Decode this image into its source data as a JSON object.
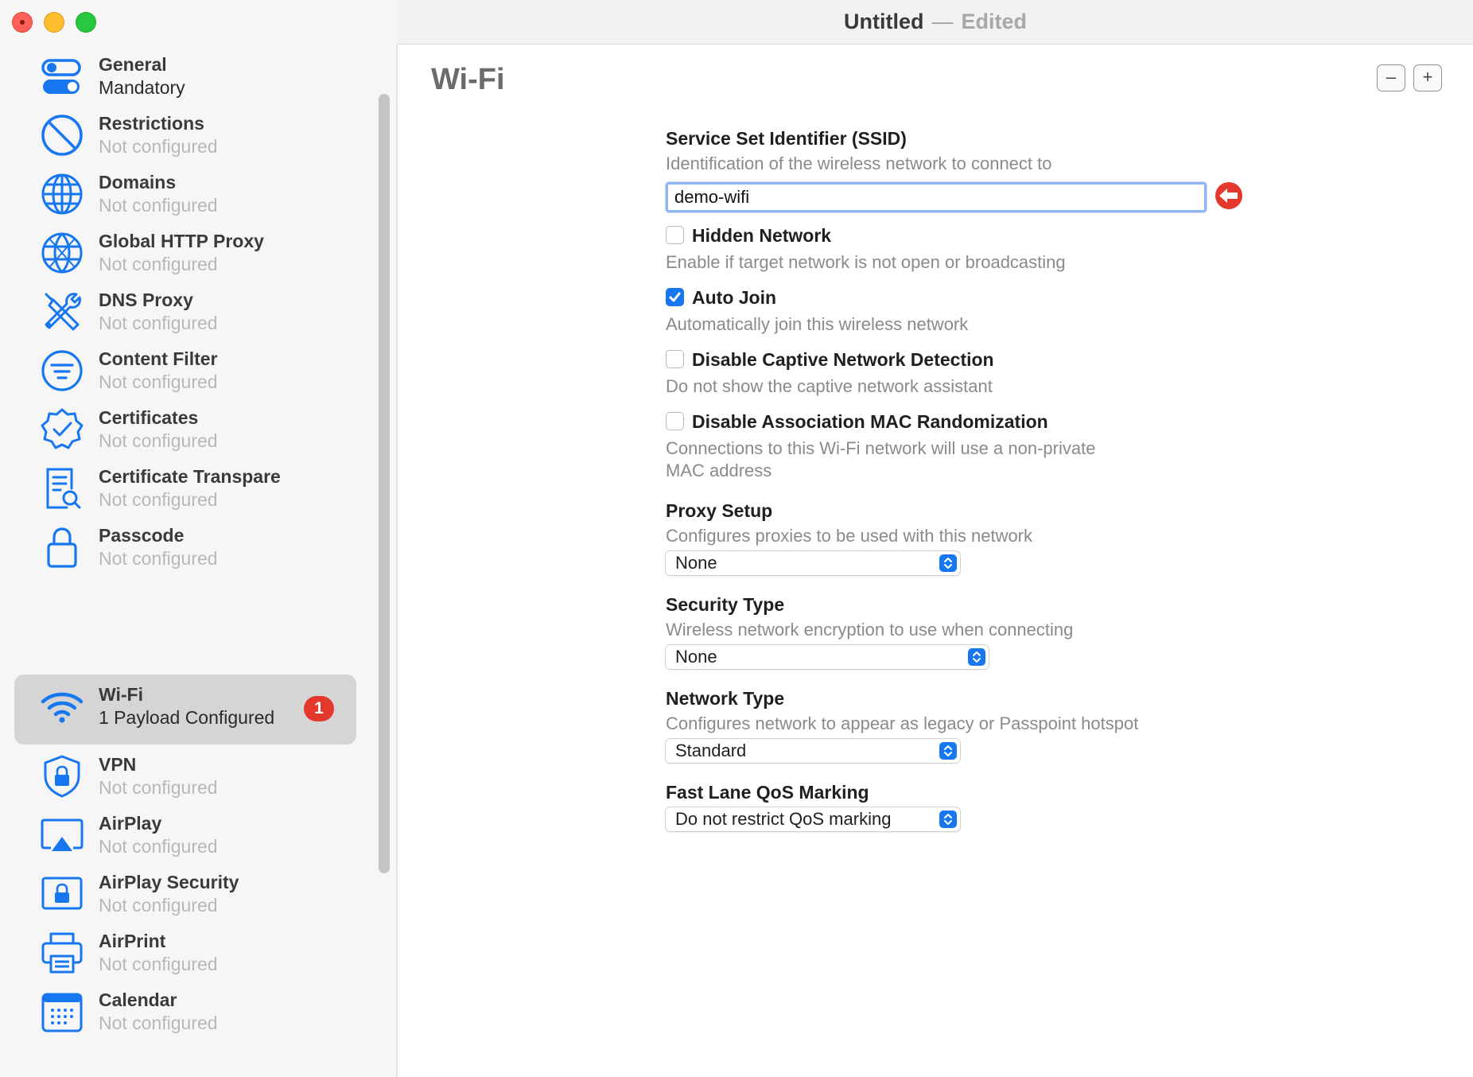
{
  "window": {
    "title": "Untitled",
    "separator": "—",
    "status": "Edited"
  },
  "sidebar": {
    "items": [
      {
        "title": "General",
        "subtitle": "Mandatory",
        "icon": "toggle-icon"
      },
      {
        "title": "Restrictions",
        "subtitle": "Not configured",
        "icon": "prohibited-icon"
      },
      {
        "title": "Domains",
        "subtitle": "Not configured",
        "icon": "globe-icon"
      },
      {
        "title": "Global HTTP Proxy",
        "subtitle": "Not configured",
        "icon": "globe-network-icon"
      },
      {
        "title": "DNS Proxy",
        "subtitle": "Not configured",
        "icon": "tools-icon"
      },
      {
        "title": "Content Filter",
        "subtitle": "Not configured",
        "icon": "filter-icon"
      },
      {
        "title": "Certificates",
        "subtitle": "Not configured",
        "icon": "certificate-icon"
      },
      {
        "title": "Certificate Transpare",
        "subtitle": "Not configured",
        "icon": "document-search-icon"
      },
      {
        "title": "Passcode",
        "subtitle": "Not configured",
        "icon": "lock-icon"
      },
      {
        "title": "Wi-Fi",
        "subtitle": "1 Payload Configured",
        "icon": "wifi-icon",
        "badge": "1"
      },
      {
        "title": "VPN",
        "subtitle": "Not configured",
        "icon": "shield-lock-icon"
      },
      {
        "title": "AirPlay",
        "subtitle": "Not configured",
        "icon": "airplay-icon"
      },
      {
        "title": "AirPlay Security",
        "subtitle": "Not configured",
        "icon": "airplay-lock-icon"
      },
      {
        "title": "AirPrint",
        "subtitle": "Not configured",
        "icon": "printer-icon"
      },
      {
        "title": "Calendar",
        "subtitle": "Not configured",
        "icon": "calendar-icon"
      }
    ]
  },
  "main": {
    "title": "Wi-Fi",
    "remove_label": "–",
    "add_label": "+",
    "ssid": {
      "title": "Service Set Identifier (SSID)",
      "desc": "Identification of the wireless network to connect to",
      "value": "demo-wifi"
    },
    "hidden_network": {
      "label": "Hidden Network",
      "desc": "Enable if target network is not open or broadcasting",
      "checked": false
    },
    "auto_join": {
      "label": "Auto Join",
      "desc": "Automatically join this wireless network",
      "checked": true
    },
    "captive": {
      "label": "Disable Captive Network Detection",
      "desc": "Do not show the captive network assistant",
      "checked": false
    },
    "mac_random": {
      "label": "Disable Association MAC Randomization",
      "desc_line1": "Connections to this Wi-Fi network will use a non-private",
      "desc_line2": "MAC address",
      "checked": false
    },
    "proxy": {
      "title": "Proxy Setup",
      "desc": "Configures proxies to be used with this network",
      "value": "None"
    },
    "security": {
      "title": "Security Type",
      "desc": "Wireless network encryption to use when connecting",
      "value": "None"
    },
    "network_type": {
      "title": "Network Type",
      "desc": "Configures network to appear as legacy or Passpoint hotspot",
      "value": "Standard"
    },
    "qos": {
      "title": "Fast Lane QoS Marking",
      "value": "Do not restrict QoS marking"
    }
  },
  "colors": {
    "accent": "#1677f0",
    "badge": "#e5382c",
    "selected_row": "#d5d5d5"
  }
}
